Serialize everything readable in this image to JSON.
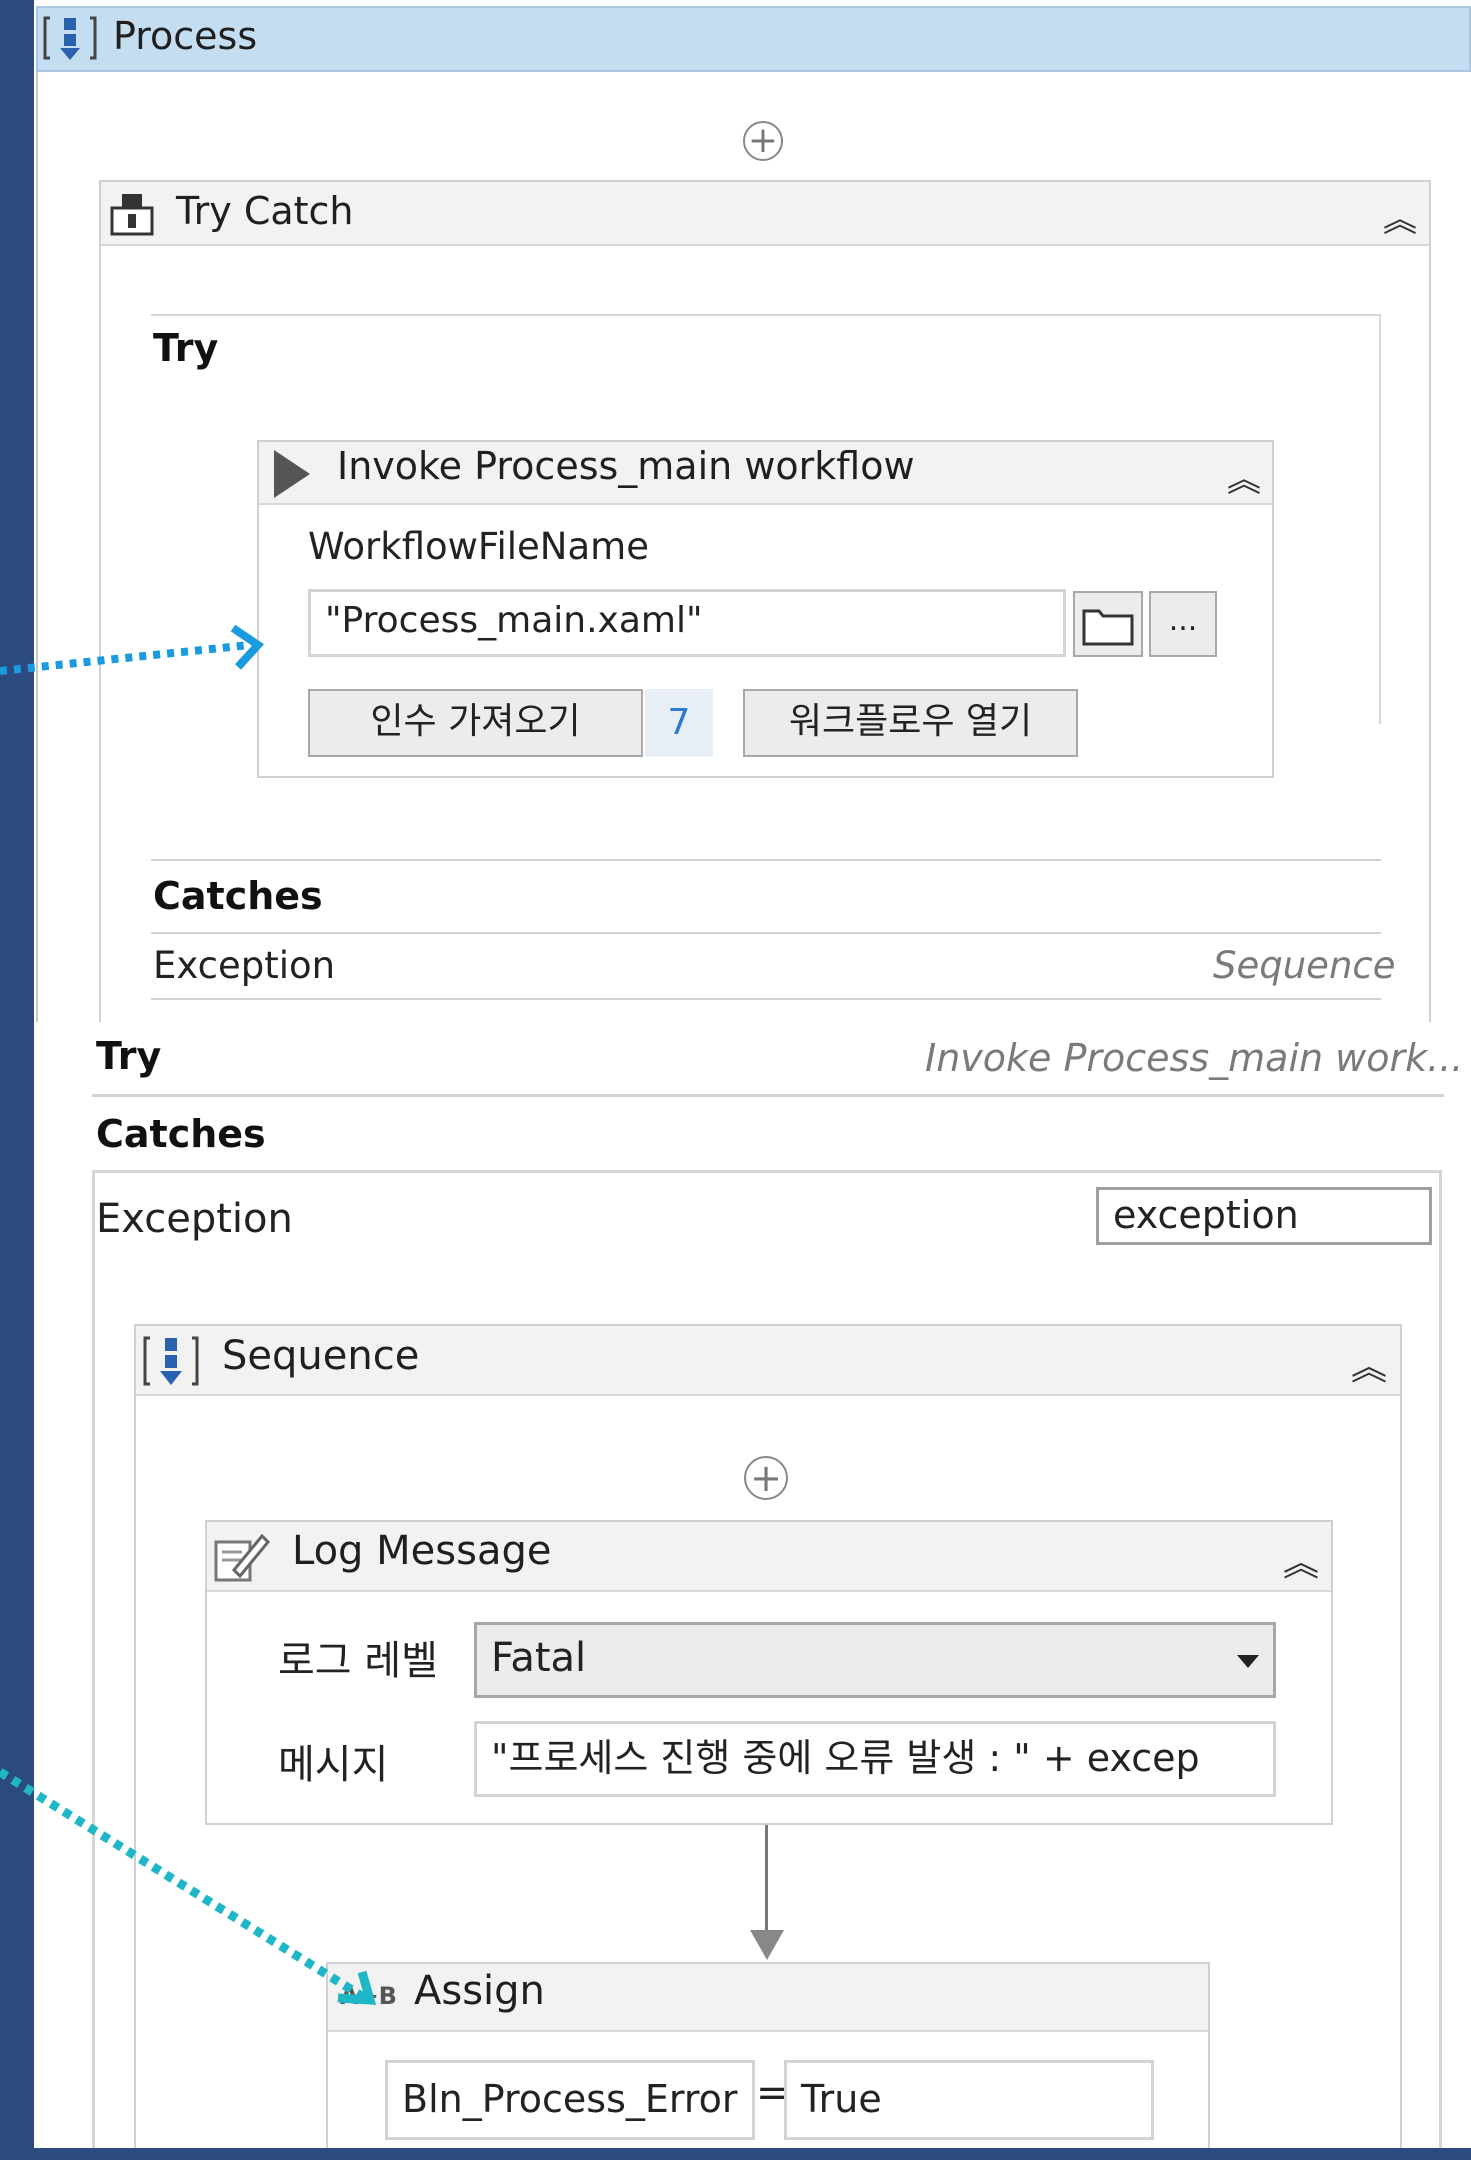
{
  "process": {
    "title": "Process"
  },
  "try_catch": {
    "title": "Try Catch",
    "try_label": "Try",
    "catches_label": "Catches",
    "exception_row": {
      "type": "Exception",
      "handler": "Sequence"
    }
  },
  "invoke": {
    "title": "Invoke Process_main workflow",
    "field_label": "WorkflowFileName",
    "file_value": "\"Process_main.xaml\"",
    "browse_more": "...",
    "import_args_label": "인수 가져오기",
    "arg_count": "7",
    "open_workflow_label": "워크플로우 열기"
  },
  "catch_detail": {
    "try_label": "Try",
    "try_summary": "Invoke Process_main work...",
    "catches_label": "Catches",
    "exception_type": "Exception",
    "exception_var": "exception"
  },
  "sequence": {
    "title": "Sequence"
  },
  "log_message": {
    "title": "Log Message",
    "level_label": "로그 레벨",
    "level_value": "Fatal",
    "message_label": "메시지",
    "message_value": "\"프로세스 진행 중에 오류 발생 : \" + excep"
  },
  "assign": {
    "title": "Assign",
    "icon_text": "A+B",
    "target": "Bln_Process_Error",
    "equals": "=",
    "value": "True"
  },
  "colors": {
    "frame": "#2b4a7e",
    "header_blue": "#c5ddf1",
    "arrow_blue": "#1a9be0",
    "arrow_teal": "#1fb6c6"
  }
}
